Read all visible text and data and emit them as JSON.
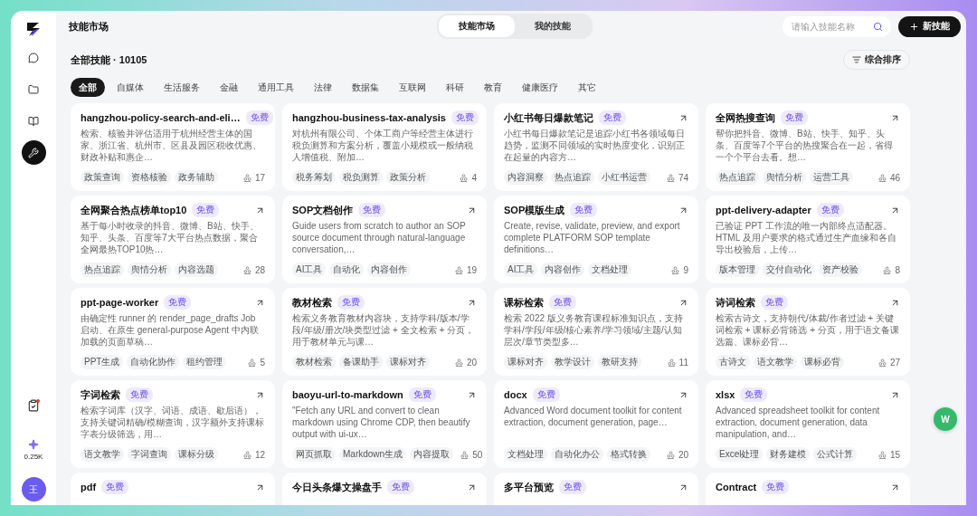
{
  "sidebar": {
    "items": [
      {
        "kind": "chat",
        "selected": false
      },
      {
        "kind": "folder",
        "selected": false
      },
      {
        "kind": "book",
        "selected": false
      },
      {
        "kind": "wrench",
        "selected": true
      }
    ],
    "tasks": {
      "notification": true
    },
    "credits": "0.25K",
    "avatar": "王"
  },
  "header": {
    "title": "技能市场",
    "segments": [
      {
        "label": "技能市场",
        "selected": true
      },
      {
        "label": "我的技能",
        "selected": false
      }
    ],
    "search": {
      "placeholder": "请输入技能名称"
    },
    "new_button": "新技能"
  },
  "section": {
    "title": "全部技能 · 10105",
    "sort_button": "综合排序"
  },
  "categories": [
    {
      "label": "全部",
      "selected": true
    },
    {
      "label": "自媒体",
      "selected": false
    },
    {
      "label": "生活服务",
      "selected": false
    },
    {
      "label": "金融",
      "selected": false
    },
    {
      "label": "通用工具",
      "selected": false
    },
    {
      "label": "法律",
      "selected": false
    },
    {
      "label": "数据集",
      "selected": false
    },
    {
      "label": "互联网",
      "selected": false
    },
    {
      "label": "科研",
      "selected": false
    },
    {
      "label": "教育",
      "selected": false
    },
    {
      "label": "健康医疗",
      "selected": false
    },
    {
      "label": "其它",
      "selected": false
    }
  ],
  "cards": [
    {
      "title": "hangzhou-policy-search-and-eli…",
      "badge": "免费",
      "description": "检索、核验并评估适用于杭州经营主体的国家、浙江省、杭州市、区县及园区税收优惠、财政补贴和惠企…",
      "tags": [
        "政策查询",
        "资格核验",
        "政务辅助"
      ],
      "count": "17"
    },
    {
      "title": "hangzhou-business-tax-analysis",
      "badge": "免费",
      "description": "对杭州有限公司、个体工商户等经营主体进行税负测算和方案分析，覆盖小规模或一般纳税人增值税、附加…",
      "tags": [
        "税务筹划",
        "税负测算",
        "政策分析"
      ],
      "count": "4"
    },
    {
      "title": "小红书每日爆款笔记",
      "badge": "免费",
      "description": "小红书每日爆款笔记是追踪小红书各领域每日趋势，监测不同领域的实时热度变化，识别正在起量的内容方…",
      "tags": [
        "内容洞察",
        "热点追踪",
        "小红书运营"
      ],
      "count": "74"
    },
    {
      "title": "全网热搜查询",
      "badge": "免费",
      "description": "帮你把抖音、微博、B站、快手、知乎、头条、百度等7个平台的热搜聚合在一起，省得一个个平台去看。想…",
      "tags": [
        "热点追踪",
        "舆情分析",
        "运营工具"
      ],
      "count": "46"
    },
    {
      "title": "全网聚合热点榜单top10",
      "badge": "免费",
      "description": "基于每小时收录的抖音、微博、B站、快手、知乎、头条、百度等7大平台热点数据，聚合全网最热TOP10热…",
      "tags": [
        "热点追踪",
        "舆情分析",
        "内容选题"
      ],
      "count": "28"
    },
    {
      "title": "SOP文档创作",
      "badge": "免费",
      "description": "Guide users from scratch to author an SOP source document through natural-language conversation,…",
      "tags": [
        "AI工具",
        "自动化",
        "内容创作"
      ],
      "count": "19"
    },
    {
      "title": "SOP模版生成",
      "badge": "免费",
      "description": "Create, revise, validate, preview, and export complete PLATFORM SOP template definitions…",
      "tags": [
        "AI工具",
        "内容创作",
        "文档处理"
      ],
      "count": "9"
    },
    {
      "title": "ppt-delivery-adapter",
      "badge": "免费",
      "description": "已验证 PPT 工作流的唯一内部终点适配器。HTML 及用户要求的格式通过生产血缘和各自导出校验后，上传…",
      "tags": [
        "版本管理",
        "交付自动化",
        "资产校验"
      ],
      "count": "8"
    },
    {
      "title": "ppt-page-worker",
      "badge": "免费",
      "description": "由确定性 runner 的 render_page_drafts Job 启动、在原生 general-purpose Agent 中内联加载的页面草稿…",
      "tags": [
        "PPT生成",
        "自动化协作",
        "租约管理"
      ],
      "count": "5"
    },
    {
      "title": "教材检索",
      "badge": "免费",
      "description": "检索义务教育教材内容块，支持学科/版本/学段/年级/册次/块类型过滤 + 全文检索 + 分页，用于教材单元与课…",
      "tags": [
        "教材检索",
        "备课助手",
        "课标对齐"
      ],
      "count": "20"
    },
    {
      "title": "课标检索",
      "badge": "免费",
      "description": "检索 2022 版义务教育课程标准知识点，支持学科/学段/年级/核心素养/学习领域/主题/认知层次/章节类型多…",
      "tags": [
        "课标对齐",
        "教学设计",
        "教研支持"
      ],
      "count": "11"
    },
    {
      "title": "诗词检索",
      "badge": "免费",
      "description": "检索古诗文，支持朝代/体裁/作者过滤 + 关键词检索 + 课标必背筛选 + 分页，用于语文备课选篇、课标必背…",
      "tags": [
        "古诗文",
        "语文教学",
        "课标必背"
      ],
      "count": "27"
    },
    {
      "title": "字词检索",
      "badge": "免费",
      "description": "检索字词库（汉字、词语、成语、歇后语），支持关键词精确/模糊查询，汉字额外支持课标字表分级筛选，用…",
      "tags": [
        "语文教学",
        "字词查询",
        "课标分级"
      ],
      "count": "12"
    },
    {
      "title": "baoyu-url-to-markdown",
      "badge": "免费",
      "description": "\"Fetch any URL and convert to clean markdown using Chrome CDP, then beautify output with ui-ux…",
      "tags": [
        "网页抓取",
        "Markdown生成",
        "内容提取"
      ],
      "count": "50"
    },
    {
      "title": "docx",
      "badge": "免费",
      "description": "Advanced Word document toolkit for content extraction, document generation, page…",
      "tags": [
        "文档处理",
        "自动化办公",
        "格式转换"
      ],
      "count": "20"
    },
    {
      "title": "xlsx",
      "badge": "免费",
      "description": "Advanced spreadsheet toolkit for content extraction, document generation, data manipulation, and…",
      "tags": [
        "Excel处理",
        "财务建模",
        "公式计算"
      ],
      "count": "15"
    },
    {
      "title": "pdf",
      "badge": "免费"
    },
    {
      "title": "今日头条爆文操盘手",
      "badge": "免费"
    },
    {
      "title": "多平台预览",
      "badge": "免费"
    },
    {
      "title": "Contract",
      "badge": "免费"
    }
  ],
  "floating_button": "W"
}
